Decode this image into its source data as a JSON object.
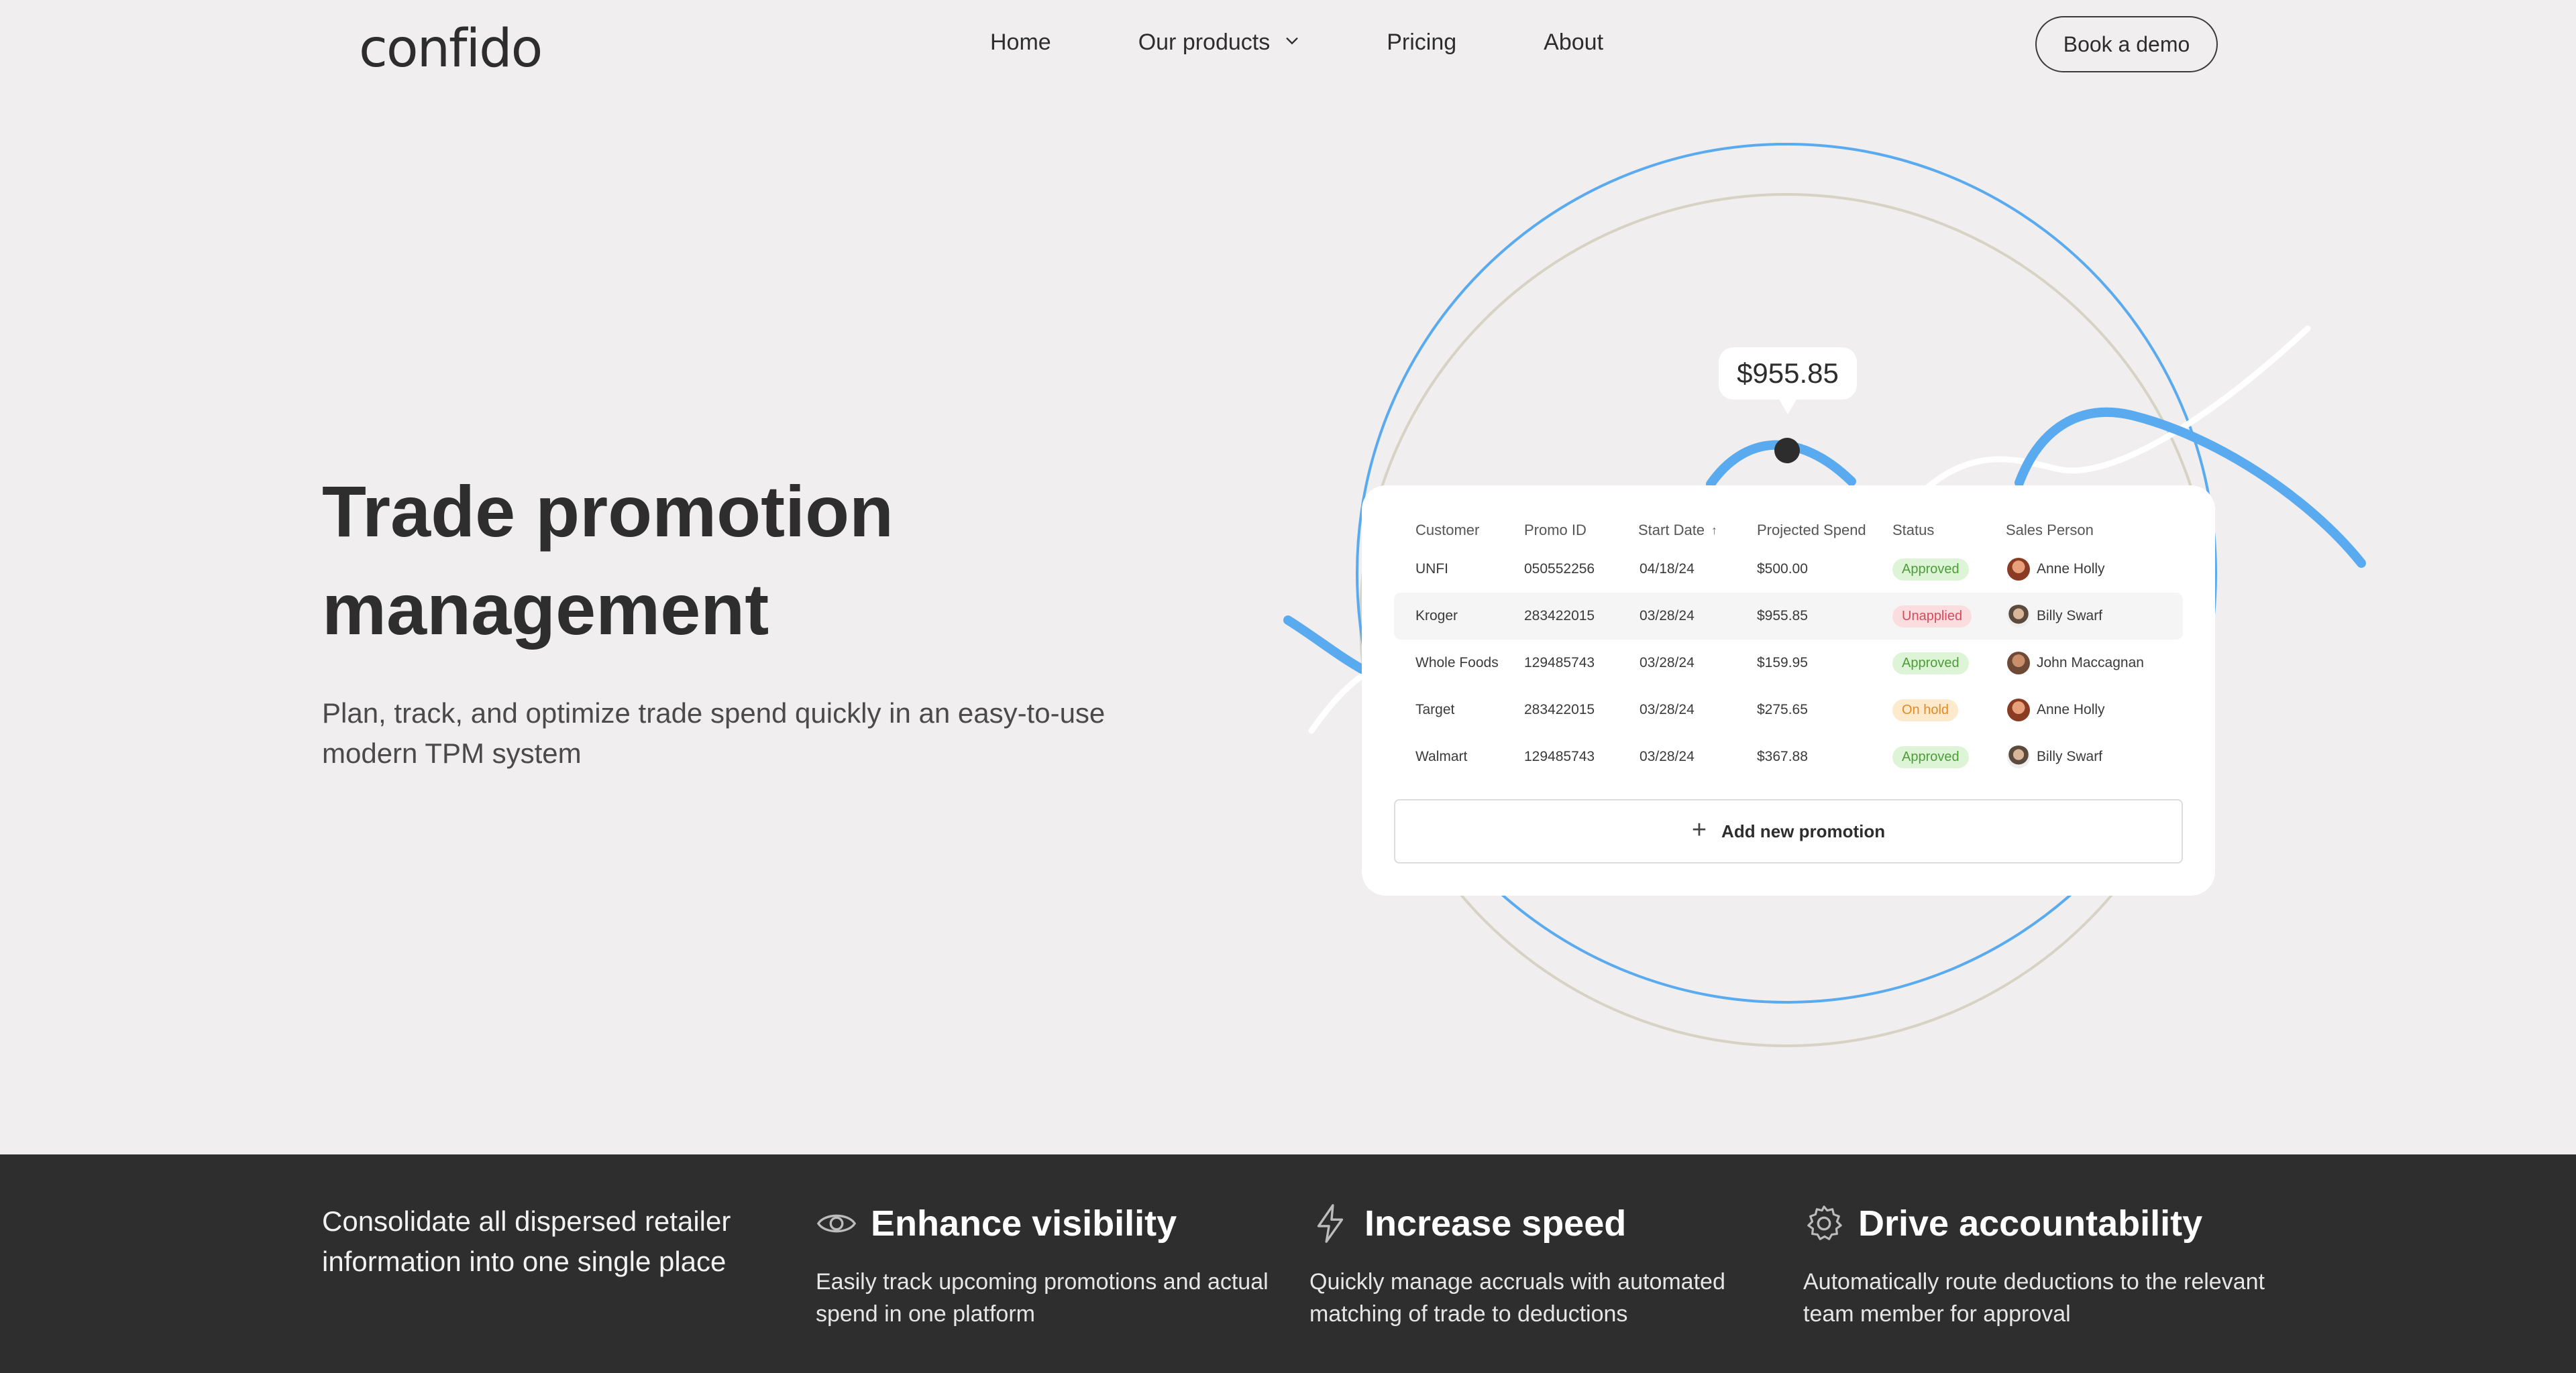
{
  "nav": {
    "logo": "confido",
    "links": [
      "Home",
      "Our products",
      "Pricing",
      "About"
    ],
    "cta": "Book a demo"
  },
  "hero": {
    "title_line1": "Trade promotion",
    "title_line2": "management",
    "subtitle": "Plan, track, and optimize trade spend quickly in an easy-to-use modern TPM system"
  },
  "illustration": {
    "price": "$955.85"
  },
  "table": {
    "headers": [
      "Customer",
      "Promo ID",
      "Start Date",
      "Projected Spend",
      "Status",
      "Sales Person"
    ],
    "rows": [
      {
        "customer": "UNFI",
        "promo_id": "050552256",
        "start_date": "04/18/24",
        "spend": "$500.00",
        "status": "Approved",
        "person": "Anne Holly"
      },
      {
        "customer": "Kroger",
        "promo_id": "283422015",
        "start_date": "03/28/24",
        "spend": "$955.85",
        "status": "Unapplied",
        "person": "Billy Swarf"
      },
      {
        "customer": "Whole Foods",
        "promo_id": "129485743",
        "start_date": "03/28/24",
        "spend": "$159.95",
        "status": "Approved",
        "person": "John Maccagnan"
      },
      {
        "customer": "Target",
        "promo_id": "283422015",
        "start_date": "03/28/24",
        "spend": "$275.65",
        "status": "On hold",
        "person": "Anne Holly"
      },
      {
        "customer": "Walmart",
        "promo_id": "129485743",
        "start_date": "03/28/24",
        "spend": "$367.88",
        "status": "Approved",
        "person": "Billy Swarf"
      }
    ],
    "add_button": "Add new promotion"
  },
  "band": {
    "intro": "Consolidate all dispersed retailer information into one single place",
    "features": [
      {
        "icon": "eye-icon",
        "title": "Enhance visibility",
        "desc": "Easily track upcoming promotions and actual spend in one platform"
      },
      {
        "icon": "lightning-icon",
        "title": "Increase speed",
        "desc": "Quickly manage accruals with automated matching of trade to deductions"
      },
      {
        "icon": "gear-icon",
        "title": "Drive accountability",
        "desc": "Automatically route deductions to the relevant team member for approval"
      }
    ]
  },
  "colors": {
    "page_bg": "#f0eeef",
    "band_bg": "#2e2e2e",
    "accent_blue": "#5aaaf0",
    "ring_beige": "#d6d2c4",
    "approved": "#4d9c3a",
    "unapplied": "#d84a5a",
    "on_hold": "#e58a21"
  }
}
